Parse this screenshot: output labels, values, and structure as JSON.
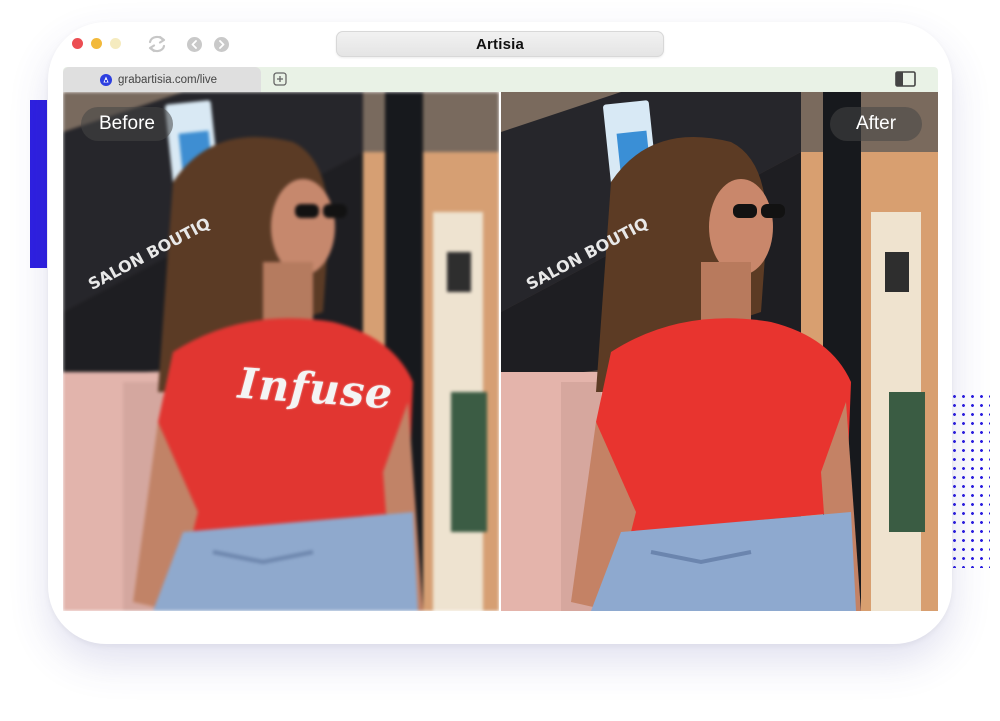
{
  "browser": {
    "title": "Artisia",
    "tab": {
      "url": "grabartisia.com/live"
    }
  },
  "comparison": {
    "before_label": "Before",
    "after_label": "After",
    "shirt_text_before": "Infuse",
    "storefront_sign": "SALON BOUTIQ"
  },
  "colors": {
    "accent": "#2d1fe0",
    "tabbar": "#e9f2e6",
    "shirt": "#e8342f"
  },
  "icons": [
    "refresh-icon",
    "back-icon",
    "forward-icon",
    "favicon-icon",
    "new-tab-icon",
    "sidebar-toggle-icon"
  ]
}
